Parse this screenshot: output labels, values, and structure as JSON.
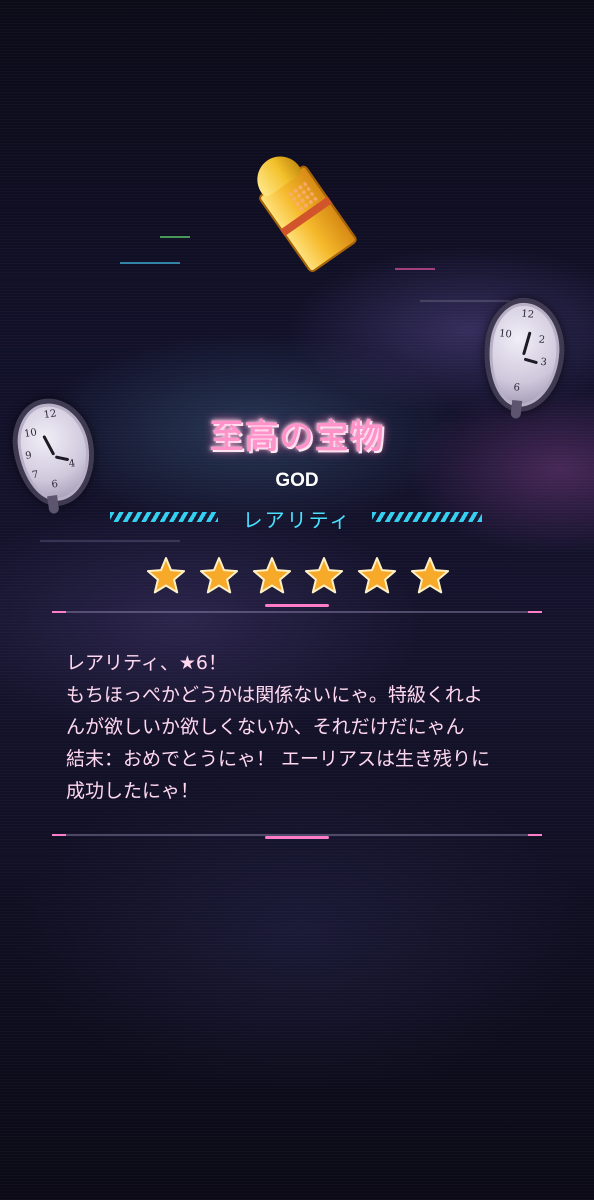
{
  "item": {
    "name": "至高の宝物",
    "rank": "GOD",
    "rarity_label": "レアリティ",
    "rarity_stars": 6,
    "icon": "golden-bullet-icon"
  },
  "description": {
    "lines": [
      "レアリティ、★6！",
      "もちほっぺかどうかは関係ないにゃ。特級くれよ",
      "んが欲しいか欲しくないか、それだけだにゃん",
      "結末：おめでとうにゃ！ エーリアスは生き残りに",
      "成功したにゃ！"
    ]
  },
  "decor": {
    "left_clock_icon": "melting-clock-icon",
    "right_clock_icon": "melting-clock-icon"
  },
  "colors": {
    "title_pink": "#ff93c9",
    "rarity_cyan": "#49e1ff",
    "star_gold": "#f7a92a",
    "accent_pink": "#ff7dc8"
  }
}
